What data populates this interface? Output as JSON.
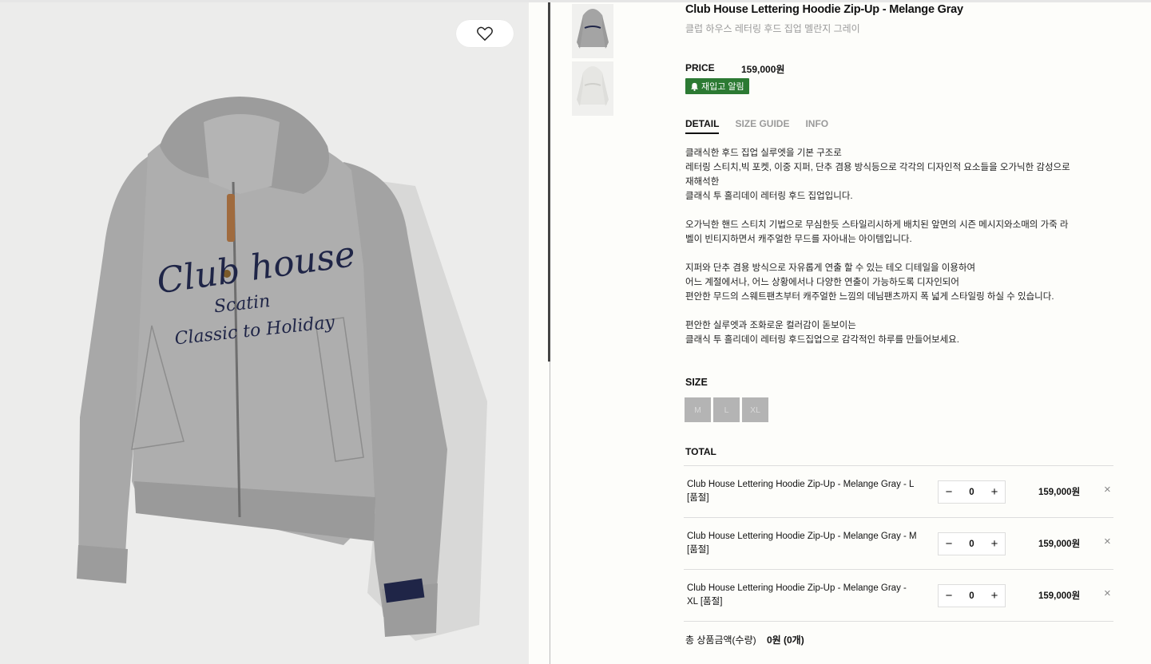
{
  "product": {
    "title": "Club House Lettering Hoodie Zip-Up - Melange Gray",
    "subtitle": "클럽 하우스 레터링 후드 집업 멜란지 그레이",
    "price_label": "PRICE",
    "price": "159,000원",
    "restock_label": "재입고 알림",
    "image_lettering": [
      "Club house",
      "Scatin",
      "Classic to Holiday"
    ]
  },
  "tabs": [
    {
      "label": "DETAIL"
    },
    {
      "label": "SIZE GUIDE"
    },
    {
      "label": "INFO"
    }
  ],
  "description": {
    "p1": [
      "클래식한 후드 집업 실루엣을 기본 구조로",
      "레터링 스티치,빅 포켓, 이중 지퍼, 단추 겸용 방식등으로 각각의 디자인적 요소들을 오가닉한 감성으로",
      "재해석한",
      "클래식 투 홀리데이 레터링 후드 집업입니다."
    ],
    "p2": [
      "오가닉한 핸드 스티치 기법으로 무심한듯 스타일리시하게 배치된 앞면의 시즌 메시지와소매의 가죽 라",
      "벨이 빈티지하면서 캐주얼한 무드를 자아내는 아이템입니다."
    ],
    "p3": [
      "지퍼와 단추 겸용 방식으로 자유롭게 연출 할 수 있는 테오 디테일을 이용하여",
      "어느 계절에서나, 어느 상황에서나 다양한 연출이 가능하도록 디자인되어",
      "편안한 무드의 스웨트팬츠부터 캐주얼한 느낌의 데님팬츠까지 폭 넓게 스타일링 하실 수 있습니다."
    ],
    "p4": [
      "편안한 실루엣과 조화로운 컬러감이 돋보이는",
      "클래식 투 홀리데이 레터링 후드집업으로 감각적인 하루를 만들어보세요."
    ]
  },
  "size": {
    "label": "SIZE",
    "options": [
      "M",
      "L",
      "XL"
    ]
  },
  "total": {
    "label": "TOTAL",
    "items": [
      {
        "name_line1": "Club House Lettering Hoodie Zip-Up - Melange Gray - L",
        "name_line2": "[품절]",
        "qty": "0",
        "price": "159,000원"
      },
      {
        "name_line1": "Club House Lettering Hoodie Zip-Up - Melange Gray - M",
        "name_line2": "[품절]",
        "qty": "0",
        "price": "159,000원"
      },
      {
        "name_line1": "Club House Lettering Hoodie Zip-Up - Melange Gray -",
        "name_line2": "XL [품절]",
        "qty": "0",
        "price": "159,000원"
      }
    ],
    "sum_label": "총 상품금액(수량)",
    "sum_value": "0원 (0개)"
  },
  "icons": {
    "wishlist": "heart-icon",
    "restock": "bell-icon",
    "minus": "minus-icon",
    "plus": "plus-icon",
    "remove": "close-icon"
  },
  "colors": {
    "restock_green": "#2c7a33",
    "lettering_navy": "#1f2547",
    "hoodie_gray": "#a9a9a9"
  }
}
